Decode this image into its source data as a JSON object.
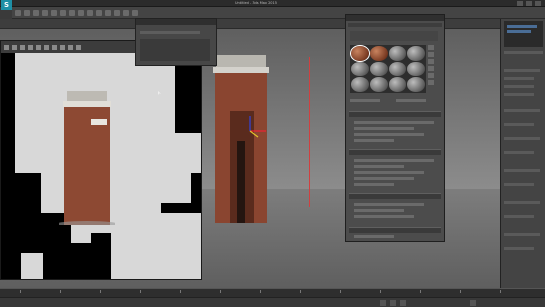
{
  "app": {
    "title": "Untitled - 3ds Max 2015",
    "icon_letter": "S"
  },
  "colors": {
    "accent": "#1e8fa6",
    "brick": "#8a4530",
    "background": "#3a3a3a"
  },
  "icons": [
    "app-icon",
    "render-toolbar-icons",
    "material-sphere",
    "gizmo-axis-icon",
    "play-icon"
  ]
}
